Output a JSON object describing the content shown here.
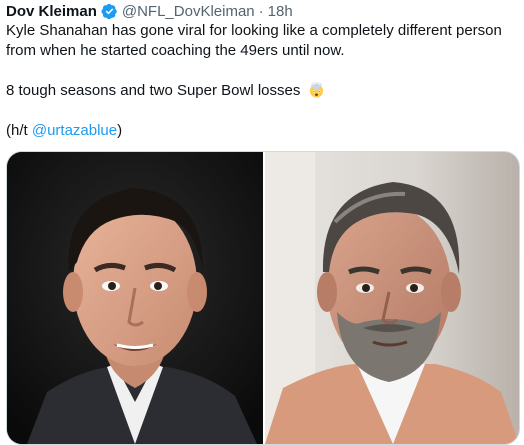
{
  "tweet": {
    "author_name": "Dov Kleiman",
    "handle": "@NFL_DovKleiman",
    "separator": "·",
    "time": "18h",
    "text_line1": "Kyle Shanahan has gone viral for looking like a completely different person from when he started coaching the 49ers until now.",
    "text_line2": "8 tough seasons and two Super Bowl losses",
    "emoji": "exploding-head-emoji",
    "ht_prefix": "(h/t ",
    "ht_mention": "@urtazablue",
    "ht_suffix": ")"
  },
  "media": {
    "left_photo": "portrait-young-man-suit",
    "right_photo": "portrait-older-man-beard"
  },
  "colors": {
    "text": "#0f1419",
    "secondary": "#536471",
    "link": "#1d9bf0",
    "verified": "#1d9bf0"
  }
}
